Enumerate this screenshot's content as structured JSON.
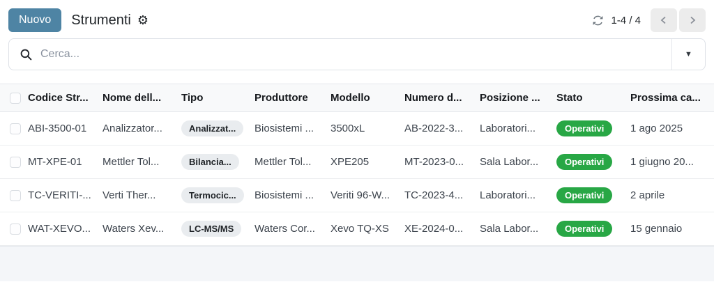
{
  "header": {
    "new_button_label": "Nuovo",
    "title": "Strumenti",
    "pager_range": "1-4 / 4"
  },
  "search": {
    "placeholder": "Cerca..."
  },
  "icons": {
    "gear": "⚙",
    "refresh": "circular-arrows",
    "search": "magnifier",
    "chevron_left": "‹",
    "chevron_right": "›",
    "caret_down": "▼"
  },
  "colors": {
    "accent": "#4e84a4",
    "status_green": "#28a745",
    "badge_gray": "#e9ecef",
    "header_bg": "#f8f9fa",
    "footer_bg": "#f4f6f9"
  },
  "table": {
    "columns": [
      "Codice Str...",
      "Nome dell...",
      "Tipo",
      "Produttore",
      "Modello",
      "Numero d...",
      "Posizione ...",
      "Stato",
      "Prossima ca..."
    ],
    "rows": [
      {
        "codice": "ABI-3500-01",
        "nome": "Analizzator...",
        "tipo": "Analizzat...",
        "produttore": "Biosistemi ...",
        "modello": "3500xL",
        "numero": "AB-2022-3...",
        "posizione": "Laboratori...",
        "stato": "Operativi",
        "prossima": "1 ago 2025"
      },
      {
        "codice": "MT-XPE-01",
        "nome": "Mettler Tol...",
        "tipo": "Bilancia...",
        "produttore": "Mettler Tol...",
        "modello": "XPE205",
        "numero": "MT-2023-0...",
        "posizione": "Sala Labor...",
        "stato": "Operativi",
        "prossima": "1 giugno 20..."
      },
      {
        "codice": "TC-VERITI-...",
        "nome": "Verti Ther...",
        "tipo": "Termocic...",
        "produttore": "Biosistemi ...",
        "modello": "Veriti 96-W...",
        "numero": "TC-2023-4...",
        "posizione": "Laboratori...",
        "stato": "Operativi",
        "prossima": "2 aprile"
      },
      {
        "codice": "WAT-XEVO...",
        "nome": "Waters Xev...",
        "tipo": "LC-MS/MS",
        "produttore": "Waters Cor...",
        "modello": "Xevo TQ-XS",
        "numero": "XE-2024-0...",
        "posizione": "Sala Labor...",
        "stato": "Operativi",
        "prossima": "15 gennaio"
      }
    ]
  }
}
